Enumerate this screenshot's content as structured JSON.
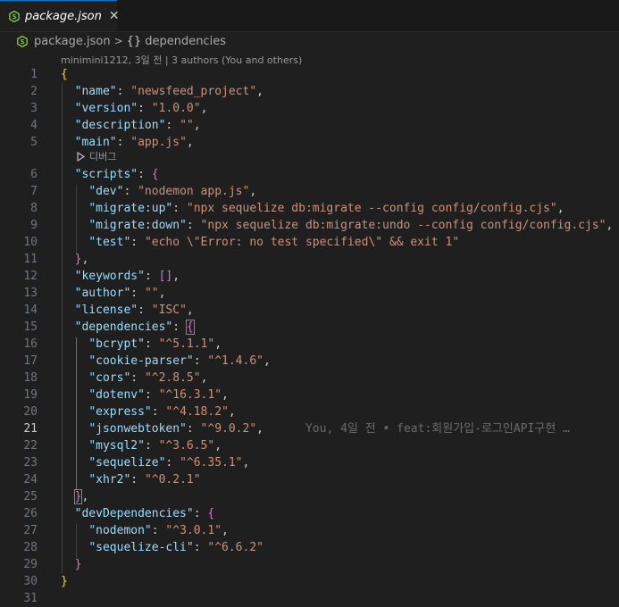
{
  "tab": {
    "title": "package.json",
    "close_glyph": "✕"
  },
  "breadcrumb": {
    "file": "package.json",
    "separator": ">",
    "braces": "{}",
    "symbol": "dependencies"
  },
  "codelens": {
    "blame": "minimini1212, 3일 전 | 3 authors (You and others)",
    "debug": "디버그"
  },
  "editor": {
    "active_line": 21,
    "inline_blame": "You, 4일 전 • feat:회원가입-로그인API구현 …",
    "lines": [
      {
        "n": "1",
        "tokens": [
          [
            "{",
            "b1"
          ]
        ]
      },
      {
        "n": "2",
        "tokens": [
          [
            "  ",
            "pun"
          ],
          [
            "\"name\"",
            "key"
          ],
          [
            ": ",
            "pun"
          ],
          [
            "\"newsfeed_project\"",
            "str"
          ],
          [
            ",",
            "pun"
          ]
        ]
      },
      {
        "n": "3",
        "tokens": [
          [
            "  ",
            "pun"
          ],
          [
            "\"version\"",
            "key"
          ],
          [
            ": ",
            "pun"
          ],
          [
            "\"1.0.0\"",
            "str"
          ],
          [
            ",",
            "pun"
          ]
        ]
      },
      {
        "n": "4",
        "tokens": [
          [
            "  ",
            "pun"
          ],
          [
            "\"description\"",
            "key"
          ],
          [
            ": ",
            "pun"
          ],
          [
            "\"\"",
            "str"
          ],
          [
            ",",
            "pun"
          ]
        ]
      },
      {
        "n": "5",
        "tokens": [
          [
            "  ",
            "pun"
          ],
          [
            "\"main\"",
            "key"
          ],
          [
            ": ",
            "pun"
          ],
          [
            "\"app.js\"",
            "str"
          ],
          [
            ",",
            "pun"
          ]
        ]
      },
      {
        "n": "6",
        "tokens": [
          [
            "  ",
            "pun"
          ],
          [
            "\"scripts\"",
            "key"
          ],
          [
            ": ",
            "pun"
          ],
          [
            "{",
            "b2"
          ]
        ]
      },
      {
        "n": "7",
        "tokens": [
          [
            "    ",
            "pun"
          ],
          [
            "\"dev\"",
            "key"
          ],
          [
            ": ",
            "pun"
          ],
          [
            "\"nodemon app.js\"",
            "str"
          ],
          [
            ",",
            "pun"
          ]
        ]
      },
      {
        "n": "8",
        "tokens": [
          [
            "    ",
            "pun"
          ],
          [
            "\"migrate:up\"",
            "key"
          ],
          [
            ": ",
            "pun"
          ],
          [
            "\"npx sequelize db:migrate --config config/config.cjs\"",
            "str"
          ],
          [
            ",",
            "pun"
          ]
        ]
      },
      {
        "n": "9",
        "tokens": [
          [
            "    ",
            "pun"
          ],
          [
            "\"migrate:down\"",
            "key"
          ],
          [
            ": ",
            "pun"
          ],
          [
            "\"npx sequelize db:migrate:undo --config config/config.cjs\"",
            "str"
          ],
          [
            ",",
            "pun"
          ]
        ]
      },
      {
        "n": "10",
        "tokens": [
          [
            "    ",
            "pun"
          ],
          [
            "\"test\"",
            "key"
          ],
          [
            ": ",
            "pun"
          ],
          [
            "\"echo \\\"Error: no test specified\\\" && exit 1\"",
            "str"
          ]
        ]
      },
      {
        "n": "11",
        "tokens": [
          [
            "  ",
            "pun"
          ],
          [
            "}",
            "b2"
          ],
          [
            ",",
            "pun"
          ]
        ]
      },
      {
        "n": "12",
        "tokens": [
          [
            "  ",
            "pun"
          ],
          [
            "\"keywords\"",
            "key"
          ],
          [
            ": ",
            "pun"
          ],
          [
            "[",
            "b2"
          ],
          [
            "]",
            "b2"
          ],
          [
            ",",
            "pun"
          ]
        ]
      },
      {
        "n": "13",
        "tokens": [
          [
            "  ",
            "pun"
          ],
          [
            "\"author\"",
            "key"
          ],
          [
            ": ",
            "pun"
          ],
          [
            "\"\"",
            "str"
          ],
          [
            ",",
            "pun"
          ]
        ]
      },
      {
        "n": "14",
        "tokens": [
          [
            "  ",
            "pun"
          ],
          [
            "\"license\"",
            "key"
          ],
          [
            ": ",
            "pun"
          ],
          [
            "\"ISC\"",
            "str"
          ],
          [
            ",",
            "pun"
          ]
        ]
      },
      {
        "n": "15",
        "tokens": [
          [
            "  ",
            "pun"
          ],
          [
            "\"dependencies\"",
            "key"
          ],
          [
            ": ",
            "pun"
          ],
          [
            "{",
            "b2 bm"
          ]
        ]
      },
      {
        "n": "16",
        "tokens": [
          [
            "    ",
            "pun"
          ],
          [
            "\"bcrypt\"",
            "key"
          ],
          [
            ": ",
            "pun"
          ],
          [
            "\"^5.1.1\"",
            "str"
          ],
          [
            ",",
            "pun"
          ]
        ]
      },
      {
        "n": "17",
        "tokens": [
          [
            "    ",
            "pun"
          ],
          [
            "\"cookie-parser\"",
            "key"
          ],
          [
            ": ",
            "pun"
          ],
          [
            "\"^1.4.6\"",
            "str"
          ],
          [
            ",",
            "pun"
          ]
        ]
      },
      {
        "n": "18",
        "tokens": [
          [
            "    ",
            "pun"
          ],
          [
            "\"cors\"",
            "key"
          ],
          [
            ": ",
            "pun"
          ],
          [
            "\"^2.8.5\"",
            "str"
          ],
          [
            ",",
            "pun"
          ]
        ]
      },
      {
        "n": "19",
        "tokens": [
          [
            "    ",
            "pun"
          ],
          [
            "\"dotenv\"",
            "key"
          ],
          [
            ": ",
            "pun"
          ],
          [
            "\"^16.3.1\"",
            "str"
          ],
          [
            ",",
            "pun"
          ]
        ]
      },
      {
        "n": "20",
        "tokens": [
          [
            "    ",
            "pun"
          ],
          [
            "\"express\"",
            "key"
          ],
          [
            ": ",
            "pun"
          ],
          [
            "\"^4.18.2\"",
            "str"
          ],
          [
            ",",
            "pun"
          ]
        ]
      },
      {
        "n": "21",
        "tokens": [
          [
            "    ",
            "pun"
          ],
          [
            "\"jsonwebtoken\"",
            "key"
          ],
          [
            ": ",
            "pun"
          ],
          [
            "\"^9.0.2\"",
            "str"
          ],
          [
            ",",
            "pun"
          ]
        ]
      },
      {
        "n": "22",
        "tokens": [
          [
            "    ",
            "pun"
          ],
          [
            "\"mysql2\"",
            "key"
          ],
          [
            ": ",
            "pun"
          ],
          [
            "\"^3.6.5\"",
            "str"
          ],
          [
            ",",
            "pun"
          ]
        ]
      },
      {
        "n": "23",
        "tokens": [
          [
            "    ",
            "pun"
          ],
          [
            "\"sequelize\"",
            "key"
          ],
          [
            ": ",
            "pun"
          ],
          [
            "\"^6.35.1\"",
            "str"
          ],
          [
            ",",
            "pun"
          ]
        ]
      },
      {
        "n": "24",
        "tokens": [
          [
            "    ",
            "pun"
          ],
          [
            "\"xhr2\"",
            "key"
          ],
          [
            ": ",
            "pun"
          ],
          [
            "\"^0.2.1\"",
            "str"
          ]
        ]
      },
      {
        "n": "25",
        "tokens": [
          [
            "  ",
            "pun"
          ],
          [
            "}",
            "b2 bm"
          ],
          [
            ",",
            "pun"
          ]
        ]
      },
      {
        "n": "26",
        "tokens": [
          [
            "  ",
            "pun"
          ],
          [
            "\"devDependencies\"",
            "key"
          ],
          [
            ": ",
            "pun"
          ],
          [
            "{",
            "b2"
          ]
        ]
      },
      {
        "n": "27",
        "tokens": [
          [
            "    ",
            "pun"
          ],
          [
            "\"nodemon\"",
            "key"
          ],
          [
            ": ",
            "pun"
          ],
          [
            "\"^3.0.1\"",
            "str"
          ],
          [
            ",",
            "pun"
          ]
        ]
      },
      {
        "n": "28",
        "tokens": [
          [
            "    ",
            "pun"
          ],
          [
            "\"sequelize-cli\"",
            "key"
          ],
          [
            ": ",
            "pun"
          ],
          [
            "\"^6.6.2\"",
            "str"
          ]
        ]
      },
      {
        "n": "29",
        "tokens": [
          [
            "  ",
            "pun"
          ],
          [
            "}",
            "b2"
          ]
        ]
      },
      {
        "n": "30",
        "tokens": [
          [
            "}",
            "b1"
          ]
        ]
      },
      {
        "n": "31",
        "tokens": []
      }
    ]
  }
}
